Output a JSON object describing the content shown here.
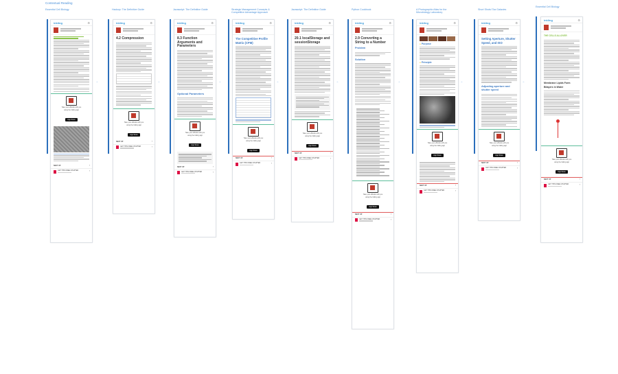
{
  "page_label": "Contextual Reading",
  "columns": [
    {
      "title": "Essential Cell Biology",
      "heading": ""
    },
    {
      "title": "Hadoop: The Definitive Guide",
      "heading": "4.2 Compression"
    },
    {
      "title": "Javascript: The Definitive Guide",
      "heading": "8.3 Function Arguments and Parameters"
    },
    {
      "title": "Strategic Management Concepts & Competitive Advantage Approach",
      "heading": "The Competitive Profile Matrix (CPM)"
    },
    {
      "title": "Javascript: The Definitive Guide",
      "heading": "20.1 localStorage and sessionStorage"
    },
    {
      "title": "Python Cookbook",
      "heading": "2.9 Converting a String to a Number"
    },
    {
      "title": "A Photographic Atlas for the Microbiology Laboratory",
      "heading": ""
    },
    {
      "title": "Short Shots! Taz Galaxies",
      "heading": "Setting Aperture, Shutter Speed, and ISO"
    },
    {
      "title": "Essential Cell Biology",
      "heading": "THE CELLS ALLOVER"
    }
  ],
  "subheads": {
    "hadoop": "Optional Parameters",
    "python_problem": "Problem",
    "python_solution": "Solution",
    "microbio_purpose": "Purpose",
    "microbio_principle": "Principle",
    "photo_adjust": "Adjusting aperture and shutter speed",
    "cell_membrane": "Membrane Lipids Form Bilayers in Water"
  },
  "logo_text": "inkling",
  "promo": {
    "line1": "Take your eBooks with you",
    "line2": "using the Inkling app",
    "appstore": "App Store"
  },
  "nav": {
    "next_up": "NEXT UP",
    "get_chapter": "GET THIS FREE CHAPTER",
    "chevron": "›"
  },
  "icons": {
    "gear": "gear-icon",
    "pdf": "pdf-icon",
    "tablet": "tablet-icon",
    "arrow": "arrow-right-icon"
  },
  "colors": {
    "accent": "#3a78c2",
    "bar": "#2a6ebb",
    "brand_green": "#8ac34a",
    "promo_border": "#5bbd9a",
    "cover_red": "#c0392b"
  }
}
